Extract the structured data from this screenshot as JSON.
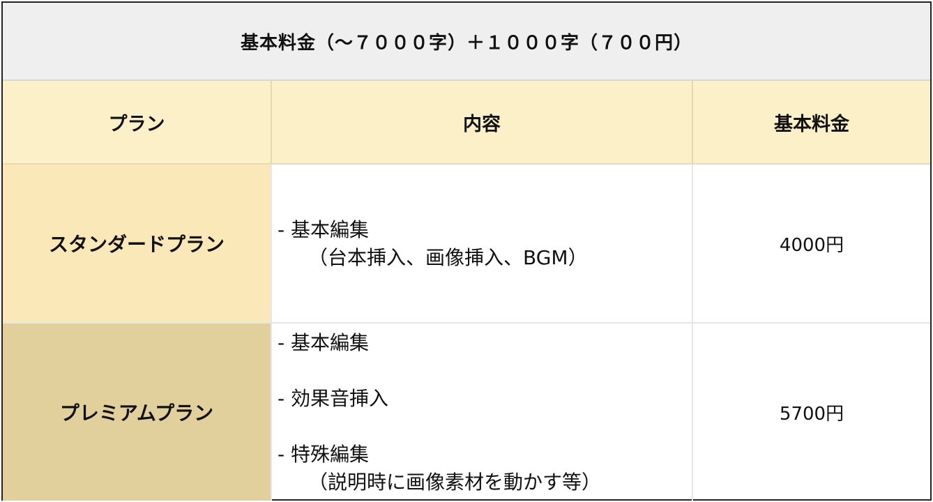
{
  "title": "基本料金（〜７０００字）＋１０００字（７００円）",
  "headers": {
    "plan": "プラン",
    "content": "内容",
    "price": "基本料金"
  },
  "rows": [
    {
      "plan": "スタンダードプラン",
      "content_lines": [
        "- 基本編集",
        "（台本挿入、画像挿入、BGM）"
      ],
      "price": "4000円"
    },
    {
      "plan": "プレミアムプラン",
      "content_lines": [
        "- 基本編集",
        "- 効果音挿入",
        "- 特殊編集",
        "（説明時に画像素材を動かす等）"
      ],
      "price": "5700円"
    }
  ],
  "colors": {
    "title_bg": "#efefef",
    "header_bg": "#fcf0c8",
    "standard_bg": "#fbe8b8",
    "premium_bg": "#e2d09c"
  }
}
